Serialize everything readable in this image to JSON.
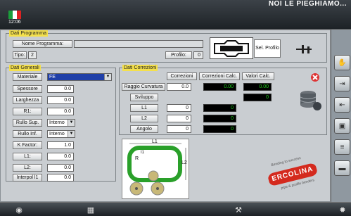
{
  "header": {
    "time": "12:06",
    "title_right": "NOI LE PIEGHIAMO..."
  },
  "programma": {
    "title": "Dati Programma",
    "nome_label": "Nome Programma:",
    "nome_value": "",
    "tipo_label": "Tipo:",
    "tipo_value": "2",
    "profilo_label": "Profilo:",
    "profilo_value": "0",
    "sel_profilo": "Sel. Profilo"
  },
  "generali": {
    "title": "Dati Generali",
    "rows": [
      {
        "label": "Materiale",
        "value": "FE"
      },
      {
        "label": "Spessore",
        "value": "0.0"
      },
      {
        "label": "Larghezza",
        "value": "0.0"
      },
      {
        "label": "R1:",
        "value": "0.0"
      },
      {
        "label": "Rullo Sup.",
        "value": "Interno"
      },
      {
        "label": "Rullo Inf.",
        "value": "Interno"
      },
      {
        "label": "K Factor:",
        "value": "1.0"
      },
      {
        "label": "L1:",
        "value": "0.0"
      },
      {
        "label": "L2:",
        "value": "0.0"
      },
      {
        "label": "Interpol l1",
        "value": "0.0"
      }
    ]
  },
  "correzioni": {
    "title": "Dati Correzioni",
    "col_correzioni": "Correzioni",
    "col_calc": "Correzioni Calc.",
    "col_valori": "Valori Calc.",
    "raggio_label": "Raggio Curvatura",
    "raggio_corr": "0.0",
    "raggio_calc": "0.00",
    "raggio_val": "0.00",
    "sviluppo_label": "Sviluppo",
    "sviluppo_val": "0",
    "l1_label": "L1",
    "l1_corr": "0",
    "l1_calc": "0",
    "l2_label": "L2",
    "l2_corr": "0",
    "l2_calc": "0",
    "angolo_label": "Angolo",
    "angolo_corr": "0",
    "angolo_calc": "0"
  },
  "diagram": {
    "l1": "L1",
    "l2": "L2",
    "r": "R",
    "i1": "I1"
  },
  "brand": {
    "name": "ERCOLINA",
    "tag_top": "Bending to success",
    "tag_bottom": "pipe & profile benders"
  },
  "colors": {
    "accent": "#f4e04c",
    "brand_red": "#d42a1e",
    "green": "#1cd41c"
  }
}
